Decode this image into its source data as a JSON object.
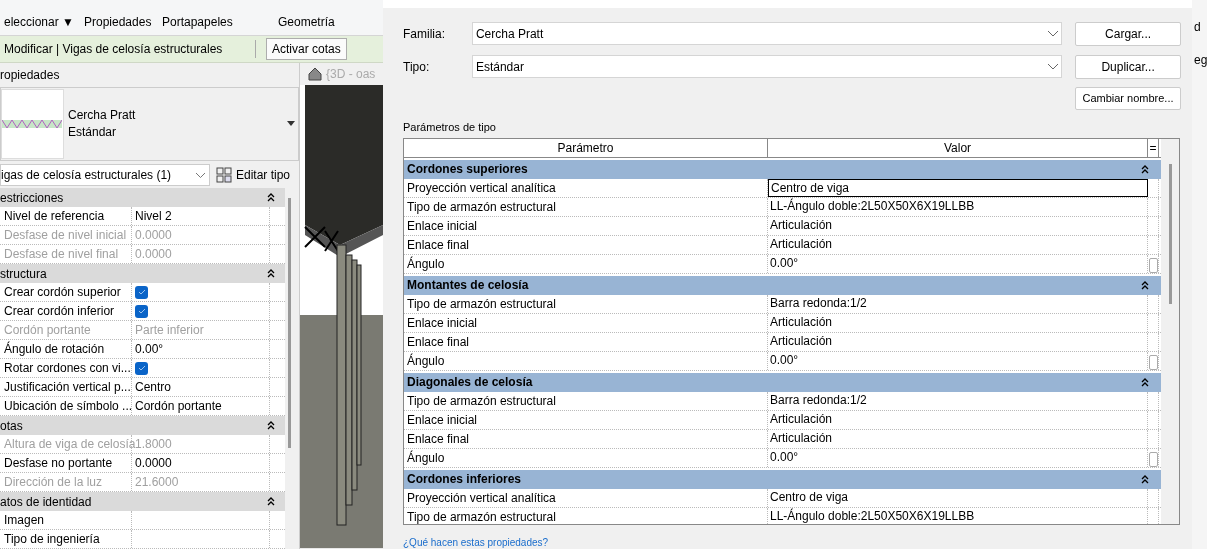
{
  "ribbon": {
    "labels": [
      "eleccionar ▼",
      "Propiedades",
      "Portapapeles",
      "Geometría"
    ]
  },
  "context_bar": {
    "title": "Modificar | Vigas de celosía estructurales",
    "button": "Activar cotas"
  },
  "properties": {
    "title": "ropiedades",
    "type_name": "Cercha Pratt",
    "type_sub": "Estándar",
    "filter": "igas de celosía estructurales (1)",
    "edit_type": "Editar tipo",
    "rows": [
      {
        "kind": "header",
        "label": "estricciones",
        "expanded": true
      },
      {
        "kind": "text",
        "label": "Nivel de referencia",
        "value": "Nivel 2",
        "disabled": false
      },
      {
        "kind": "text",
        "label": "Desfase de nivel inicial",
        "value": "0.0000",
        "disabled": true
      },
      {
        "kind": "text",
        "label": "Desfase de nivel final",
        "value": "0.0000",
        "disabled": true
      },
      {
        "kind": "header",
        "label": "structura",
        "expanded": true
      },
      {
        "kind": "check",
        "label": "Crear cordón superior",
        "checked": true,
        "disabled": false
      },
      {
        "kind": "check",
        "label": "Crear cordón inferior",
        "checked": true,
        "disabled": false
      },
      {
        "kind": "text",
        "label": "Cordón portante",
        "value": "Parte inferior",
        "disabled": true
      },
      {
        "kind": "text",
        "label": "Ángulo de rotación",
        "value": "0.00°",
        "disabled": false
      },
      {
        "kind": "check",
        "label": "Rotar cordones con vi...",
        "checked": true,
        "disabled": false
      },
      {
        "kind": "text",
        "label": "Justificación vertical p...",
        "value": "Centro",
        "disabled": false
      },
      {
        "kind": "text",
        "label": "Ubicación de símbolo ...",
        "value": "Cordón portante",
        "disabled": false
      },
      {
        "kind": "header",
        "label": "otas",
        "expanded": true
      },
      {
        "kind": "text",
        "label": "Altura de viga de celosía",
        "value": "1.8000",
        "disabled": true
      },
      {
        "kind": "text",
        "label": "Desfase no portante",
        "value": "0.0000",
        "disabled": false
      },
      {
        "kind": "text",
        "label": "Dirección de la luz",
        "value": "21.6000",
        "disabled": true
      },
      {
        "kind": "header",
        "label": "atos de identidad",
        "expanded": true
      },
      {
        "kind": "text",
        "label": "Imagen",
        "disabled": false
      },
      {
        "kind": "text",
        "label": "Tipo de ingeniería",
        "disabled": false
      }
    ]
  },
  "view_tab": {
    "title": "{3D - oas"
  },
  "dialog": {
    "family_label": "Familia:",
    "family": "Cercha Pratt",
    "type_label": "Tipo:",
    "type": "Estándar",
    "buttons": [
      "Cargar...",
      "Duplicar...",
      "Cambiar nombre..."
    ],
    "section_title": "Parámetros de tipo",
    "columns": [
      "Parámetro",
      "Valor",
      "="
    ],
    "rows": [
      {
        "kind": "header",
        "label": "Cordones superiores",
        "expanded": true
      },
      {
        "kind": "text",
        "label": "Proyección vertical analítica",
        "value": "Centro de viga",
        "selected": true
      },
      {
        "kind": "text",
        "label": "Tipo de armazón estructural",
        "value": "LL-Ángulo doble:2L50X50X6X19LLBB",
        "selected": false
      },
      {
        "kind": "text",
        "label": "Enlace inicial",
        "value": "Articulación",
        "selected": false
      },
      {
        "kind": "text",
        "label": "Enlace final",
        "value": "Articulación",
        "selected": false
      },
      {
        "kind": "angle",
        "label": "Ángulo",
        "value": "0.00°",
        "selected": false
      },
      {
        "kind": "header",
        "label": "Montantes de celosía",
        "expanded": true
      },
      {
        "kind": "text",
        "label": "Tipo de armazón estructural",
        "value": "Barra redonda:1/2",
        "selected": false
      },
      {
        "kind": "text",
        "label": "Enlace inicial",
        "value": "Articulación",
        "selected": false
      },
      {
        "kind": "text",
        "label": "Enlace final",
        "value": "Articulación",
        "selected": false
      },
      {
        "kind": "angle",
        "label": "Ángulo",
        "value": "0.00°",
        "selected": false
      },
      {
        "kind": "header",
        "label": "Diagonales de celosía",
        "expanded": true
      },
      {
        "kind": "text",
        "label": "Tipo de armazón estructural",
        "value": "Barra redonda:1/2",
        "selected": false
      },
      {
        "kind": "text",
        "label": "Enlace inicial",
        "value": "Articulación",
        "selected": false
      },
      {
        "kind": "text",
        "label": "Enlace final",
        "value": "Articulación",
        "selected": false
      },
      {
        "kind": "angle",
        "label": "Ángulo",
        "value": "0.00°",
        "selected": false
      },
      {
        "kind": "header",
        "label": "Cordones inferiores",
        "expanded": true
      },
      {
        "kind": "text",
        "label": "Proyección vertical analítica",
        "value": "Centro de viga",
        "selected": false
      },
      {
        "kind": "text",
        "label": "Tipo de armazón estructural",
        "value": "LL-Ángulo doble:2L50X50X6X19LLBB",
        "selected": false
      }
    ],
    "help_link": "¿Qué hacen estas propiedades?"
  },
  "background_fragments": [
    "d",
    "eg"
  ]
}
